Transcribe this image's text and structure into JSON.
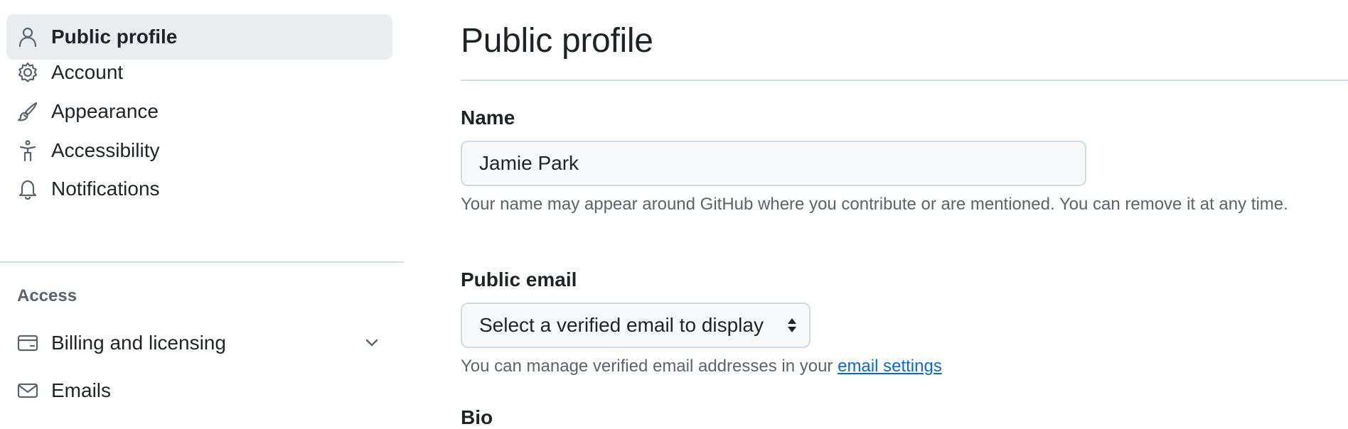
{
  "sidebar": {
    "items": [
      {
        "label": "Public profile",
        "icon": "person-icon",
        "active": true
      },
      {
        "label": "Account",
        "icon": "gear-icon"
      },
      {
        "label": "Appearance",
        "icon": "paintbrush-icon"
      },
      {
        "label": "Accessibility",
        "icon": "accessibility-icon"
      },
      {
        "label": "Notifications",
        "icon": "bell-icon"
      }
    ],
    "access_heading": "Access",
    "access_items": [
      {
        "label": "Billing and licensing",
        "icon": "credit-card-icon",
        "expand_icon": "chevron-down-icon"
      },
      {
        "label": "Emails",
        "icon": "mail-icon"
      }
    ]
  },
  "main": {
    "title": "Public profile",
    "name_field": {
      "label": "Name",
      "value": "Jamie Park",
      "help": "Your name may appear around GitHub where you contribute or are mentioned. You can remove it at any time."
    },
    "email_field": {
      "label": "Public email",
      "selected": "Select a verified email to display",
      "help_prefix": "You can manage verified email addresses in your",
      "help_link": "email settings"
    },
    "bio_field": {
      "label": "Bio"
    }
  },
  "colors": {
    "accent_link": "#0969da",
    "active_nav_bg": "#eaedf0",
    "muted_text": "#59636e",
    "border": "#d1d9e0"
  }
}
